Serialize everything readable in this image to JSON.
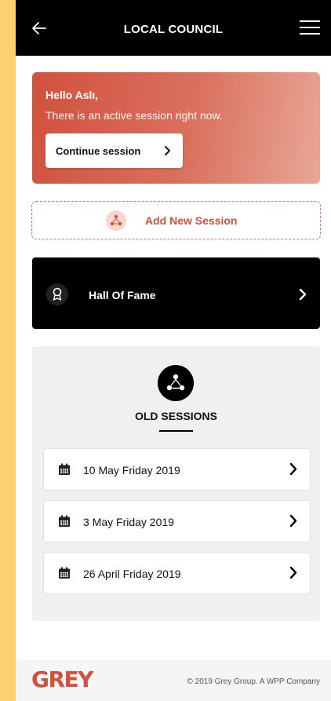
{
  "header": {
    "title": "LOCAL COUNCIL",
    "back_icon": "arrow-left-icon",
    "menu_icon": "hamburger-menu-icon"
  },
  "greeting": {
    "hello": "Hello Aslı,",
    "message": "There is an active session right now.",
    "continue_label": "Continue session"
  },
  "add_session": {
    "label": "Add New Session",
    "icon": "people-network-icon"
  },
  "hall_of_fame": {
    "label": "Hall Of Fame",
    "icon": "award-ribbon-icon"
  },
  "old_sessions": {
    "title": "OLD SESSIONS",
    "icon": "people-network-icon",
    "items": [
      {
        "label": "10 May Friday 2019"
      },
      {
        "label": "3 May Friday 2019"
      },
      {
        "label": "26 April Friday 2019"
      }
    ]
  },
  "footer": {
    "logo": "GREY",
    "copyright": "© 2019 Grey Group. A WPP Company"
  },
  "colors": {
    "accent": "#d2503e",
    "page_bg": "#ffd070",
    "dark": "#000000"
  }
}
